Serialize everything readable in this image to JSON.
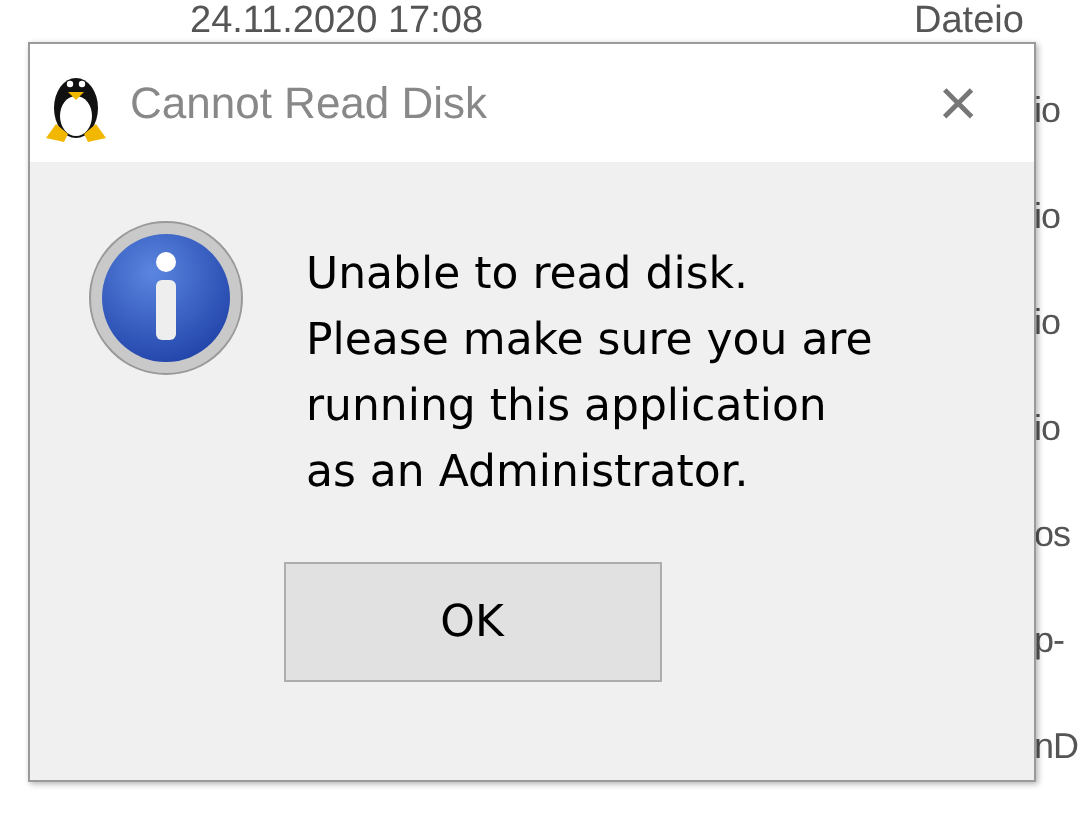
{
  "background_list": {
    "rows": [
      {
        "date": "24.11.2020 17:08",
        "name": "Dateio"
      },
      {
        "name": "io"
      },
      {
        "name": "io"
      },
      {
        "name": "io"
      },
      {
        "name": "io"
      },
      {
        "name": "os"
      },
      {
        "name": "p-"
      },
      {
        "name": "nD"
      }
    ]
  },
  "dialog": {
    "title": "Cannot Read Disk",
    "close": "×",
    "message_lines": [
      "Unable to read disk.",
      "Please make sure you are",
      "running this application",
      "as an Administrator."
    ],
    "buttons": [
      "OK"
    ]
  }
}
